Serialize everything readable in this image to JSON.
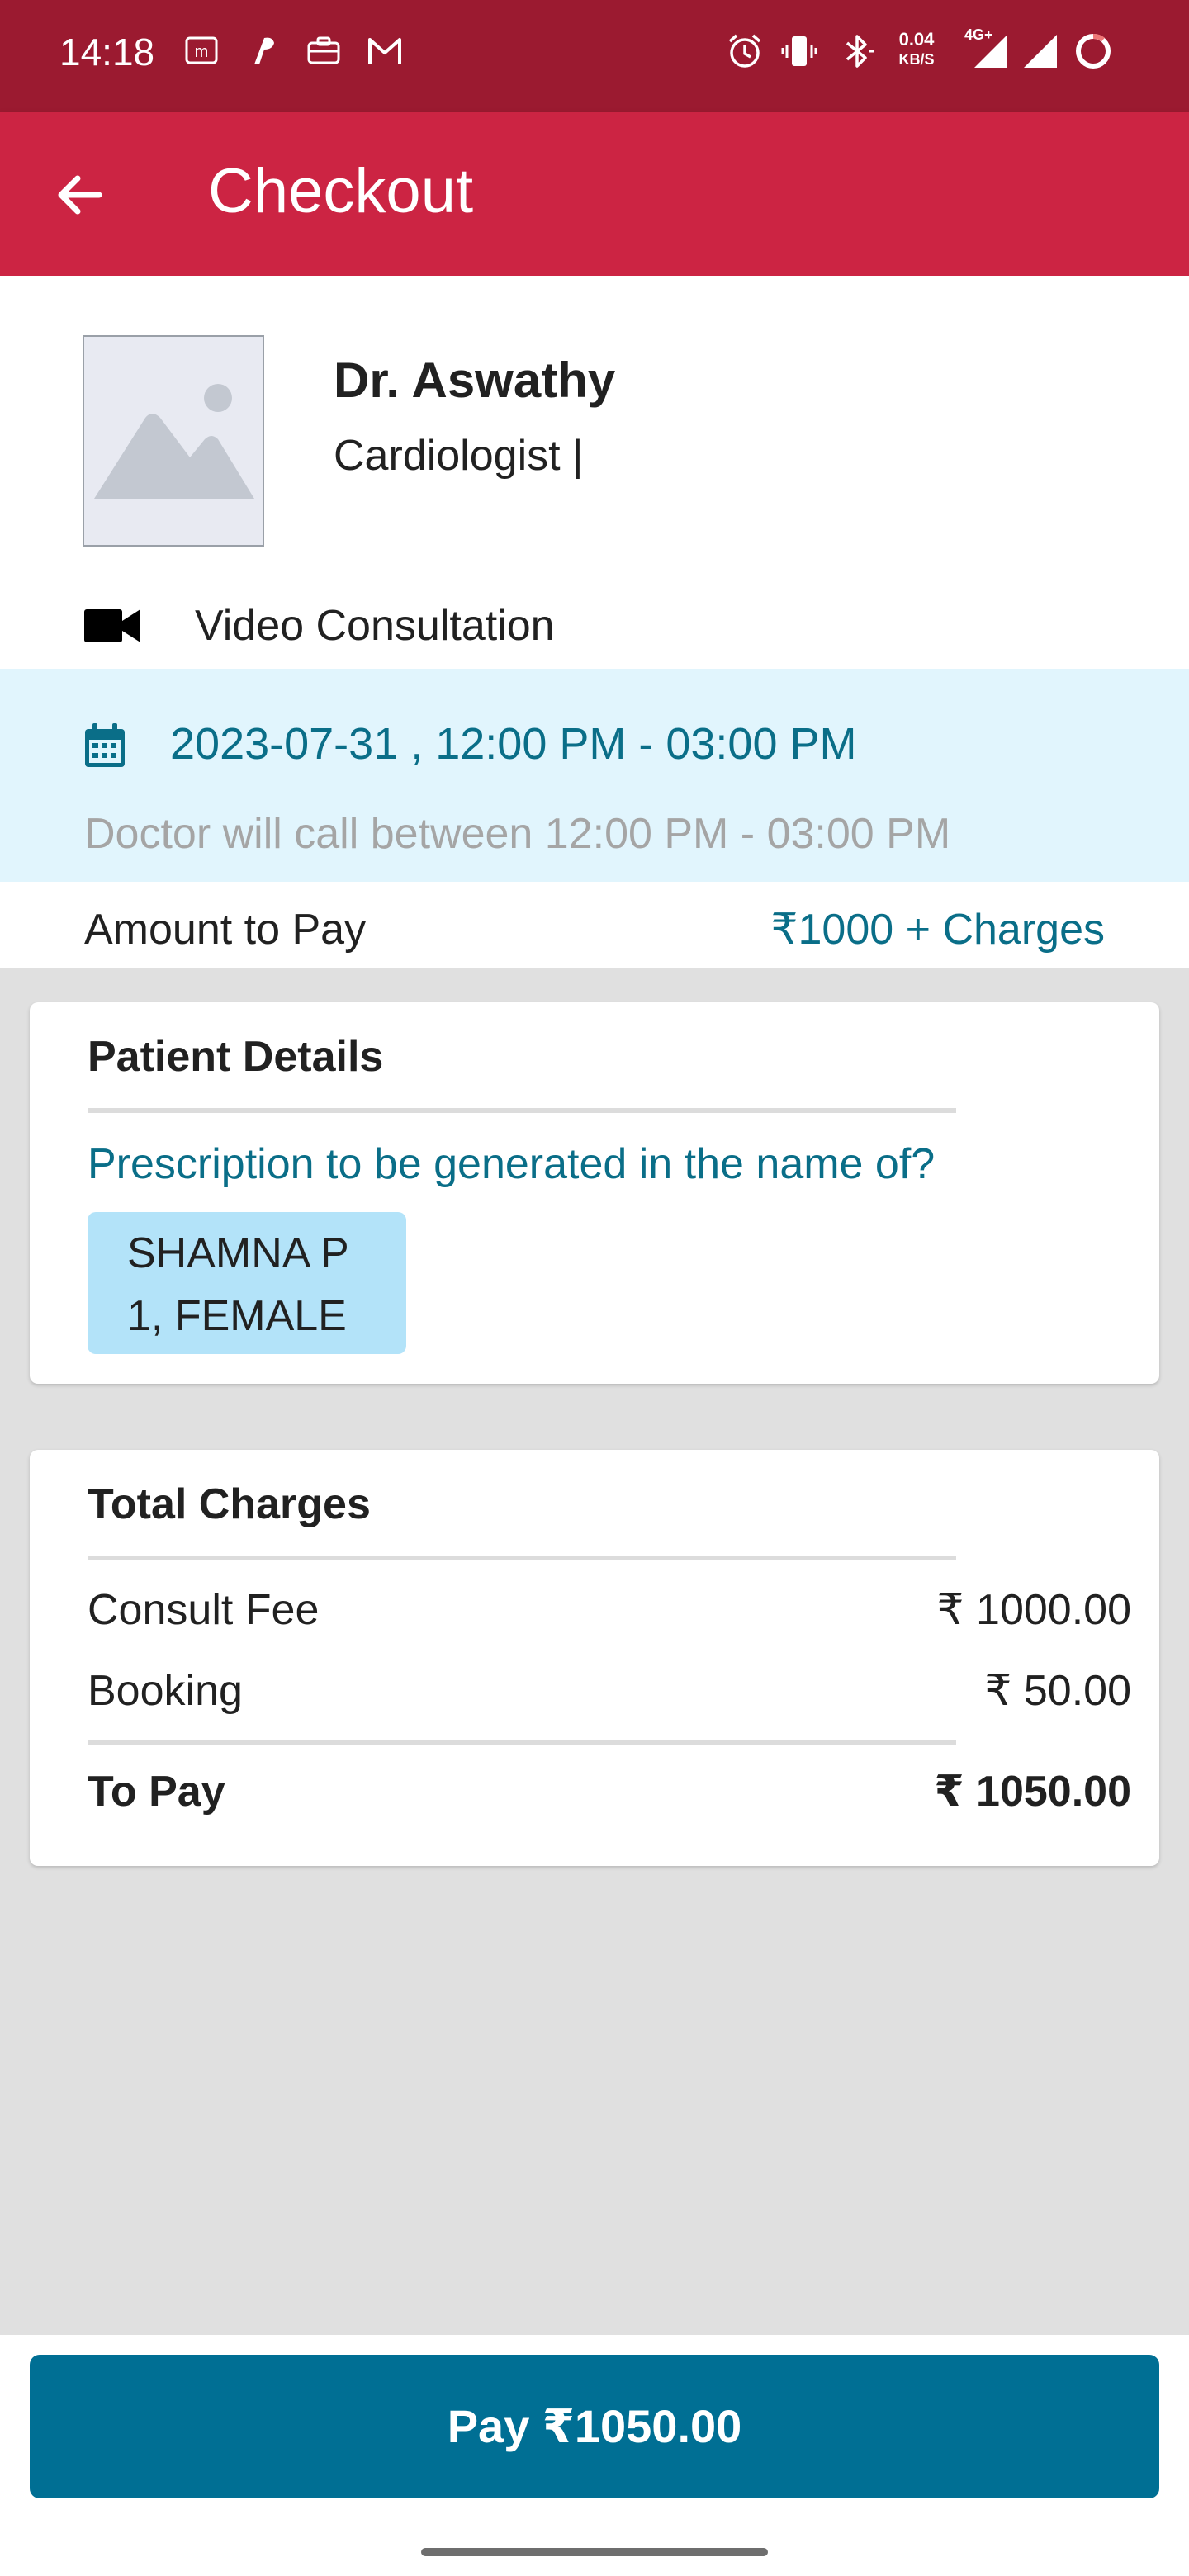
{
  "status_bar": {
    "time": "14:18",
    "net_speed": "0.04",
    "net_unit": "KB/S",
    "net_type": "4G+",
    "icons": [
      "m-notification-icon",
      "app-notification-icon",
      "briefcase-icon",
      "gmail-icon",
      "alarm-icon",
      "vibrate-icon",
      "bluetooth-icon",
      "signal-icon",
      "signal-icon",
      "battery-ring-icon"
    ]
  },
  "app_bar": {
    "title": "Checkout",
    "back_icon": "arrow-left-icon"
  },
  "doctor": {
    "name": "Dr. Aswathy",
    "specialty": "Cardiologist |",
    "photo_icon": "image-placeholder-icon"
  },
  "consultation": {
    "type": "Video Consultation",
    "icon": "video-camera-icon"
  },
  "slot": {
    "icon": "calendar-icon",
    "datetime": "2023-07-31 , 12:00 PM - 03:00 PM",
    "note": "Doctor will call between 12:00 PM - 03:00 PM"
  },
  "amount": {
    "label": "Amount to Pay",
    "value": "₹1000 + Charges"
  },
  "patient_details": {
    "heading": "Patient Details",
    "question": "Prescription to be generated in the name of?",
    "patient_name": "SHAMNA P",
    "patient_info": "1, FEMALE"
  },
  "total_charges": {
    "heading": "Total Charges",
    "rows": [
      {
        "label": "Consult Fee",
        "value": "₹ 1000.00"
      },
      {
        "label": "Booking",
        "value": "₹ 50.00"
      }
    ],
    "total": {
      "label": "To Pay",
      "value": "₹ 1050.00"
    }
  },
  "pay_button": {
    "label": "Pay ₹1050.00"
  },
  "colors": {
    "status_bar": "#9b1a30",
    "app_bar": "#cc2443",
    "accent_text": "#0a6e88",
    "slot_background": "#e1f5fd",
    "chip_background": "#b3e3f9",
    "pay_button": "#006f94",
    "page_background": "#e0e0e0"
  }
}
